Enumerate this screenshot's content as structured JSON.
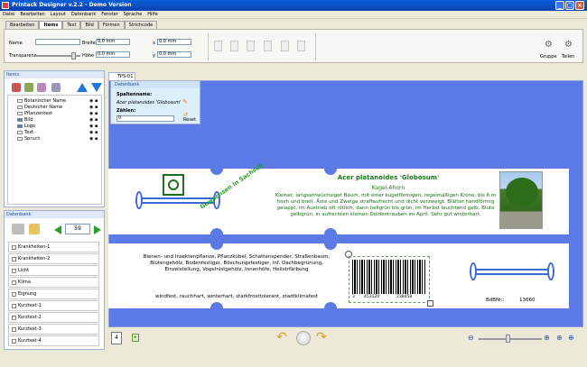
{
  "window": {
    "title": "Printack Designer v.2.2 - Demo Version"
  },
  "menu": [
    "Datei",
    "Bearbeiten",
    "Layout",
    "Datenbank",
    "Fenster",
    "Sprache",
    "Hilfe"
  ],
  "tabs": [
    {
      "label": "Bearbeiten",
      "active": false
    },
    {
      "label": "Items",
      "active": true
    },
    {
      "label": "Text",
      "active": false
    },
    {
      "label": "Bild",
      "active": false
    },
    {
      "label": "Formen",
      "active": false
    },
    {
      "label": "Strichcode",
      "active": false
    }
  ],
  "ribbon": {
    "name_label": "Name",
    "name_value": "",
    "transparency_label": "Transparenz",
    "width_label": "Breite",
    "width_value": "0,0 mm",
    "height_label": "Höhe",
    "height_value": "0,0 mm",
    "x_label": "x",
    "x_value": "0,0 mm",
    "y_label": "y",
    "y_value": "0,0 mm",
    "group_label": "Gruppe",
    "split_label": "Teilen"
  },
  "items_panel": {
    "title": "Items",
    "tree": [
      "Botanischer Name",
      "Deutscher Name",
      "Pflanzentext",
      "Bild",
      "Logo",
      "Text",
      "Spruch"
    ]
  },
  "db_panel": {
    "title": "Datenbank",
    "record": "59",
    "rows": [
      "Krankheiten-1",
      "Krankheiten-2",
      "Licht",
      "Klima",
      "Eignung",
      "Kurztext-1",
      "Kurztext-2",
      "Kurztext-3",
      "Kurztext-4"
    ]
  },
  "doc": {
    "tab": "TPS-01",
    "popup_title": "Datenbank",
    "column_label": "Spaltenname:",
    "column_value": "Acer platanoides 'Globosum'",
    "counter_label": "Zählen:",
    "counter_value": "0",
    "reset_label": "Reset"
  },
  "label_top": {
    "title": "Acer platanoides 'Globosum'",
    "subtitle": "Kugel-Ahorn",
    "body": "Kleiner, langsamwüchsiger Baum, mit einer kugelförmigen, regelmäßigen Krone, bis 6 m hoch und breit. Äste und Zweige straffaufrecht und dicht verzweigt. Blätter handförmig gelappt, im Austrieb oft rötlich, dann hellgrün bis grün, im Herbst leuchtend gelb. Blüte gelbgrün, in aufrechten kleinen Doldentrauben im April. Sehr gut winterhart.",
    "stamp": "Gewachsen in Sachsen"
  },
  "label_bottom": {
    "text1": "Bienen- und Insektenpflanze, Pflanzkübel, Schattenspender, Straßenbaum, Blütengehölz, Bodenfestiger, Böschungsfestiger, inf. Dachbegrünung, Einzelstellung, Vogelnistgehölz, Innenhöfe, Heilstrfärbung",
    "text2": "windfest, rauchhart, winterhart, starkfrosttolerant, stadtklimafest",
    "barcode_digits": [
      "3",
      "453120",
      "238458"
    ],
    "art_label": "BdBNr.:",
    "art_value": "13660"
  },
  "status": {
    "page": "4"
  }
}
